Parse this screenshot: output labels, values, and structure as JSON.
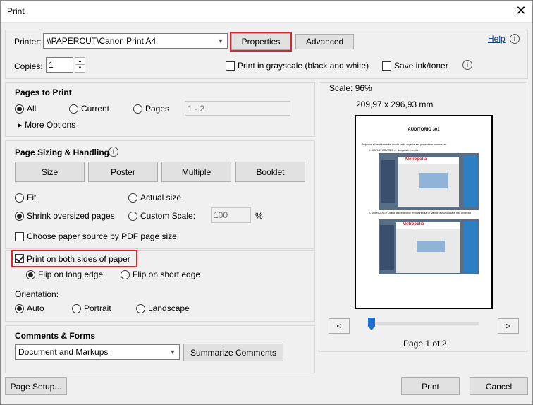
{
  "window": {
    "title": "Print"
  },
  "printer": {
    "label": "Printer:",
    "value": "\\\\PAPERCUT\\Canon Print A4",
    "properties": "Properties",
    "advanced": "Advanced",
    "help": "Help"
  },
  "copies": {
    "label": "Copies:",
    "value": "1"
  },
  "grayscale": {
    "label": "Print in grayscale (black and white)"
  },
  "save_ink": {
    "label": "Save ink/toner"
  },
  "pages_to_print": {
    "heading": "Pages to Print",
    "all": "All",
    "current": "Current",
    "pages": "Pages",
    "pages_placeholder": "1 - 2",
    "more_options": "More Options"
  },
  "sizing": {
    "heading": "Page Sizing & Handling",
    "size": "Size",
    "poster": "Poster",
    "multiple": "Multiple",
    "booklet": "Booklet",
    "fit": "Fit",
    "actual_size": "Actual size",
    "shrink": "Shrink oversized pages",
    "custom_scale": "Custom Scale:",
    "scale_value": "100",
    "percent": "%",
    "choose_source": "Choose paper source by PDF page size"
  },
  "duplex": {
    "label": "Print on both sides of paper",
    "flip_long": "Flip on long edge",
    "flip_short": "Flip on short edge"
  },
  "orientation": {
    "label": "Orientation:",
    "auto": "Auto",
    "portrait": "Portrait",
    "landscape": "Landscape"
  },
  "comments": {
    "heading": "Comments & Forms",
    "value": "Document and Markups",
    "summarize": "Summarize Comments"
  },
  "preview": {
    "scale": "Scale:  96%",
    "dimensions": "209,97 x 296,93 mm",
    "page_indicator": "Page 1 of 2",
    "prev": "<",
    "next": ">",
    "doc_title": "AUDITORIO 301",
    "doc_intro": "Projectori ei tiene kamerita, musta kablo obyekta aas proyektorim kommisaar:",
    "doc_step1": "1. DISPLAY DEVICES => Navyvesik enimeta",
    "doc_step2": "2. SOURCES => Dalisa alta projection en lisypriuoaa => Valitse laurunkuja ja el lista projektor",
    "doc_logo": "Metropolia"
  },
  "footer": {
    "page_setup": "Page Setup...",
    "print": "Print",
    "cancel": "Cancel"
  },
  "icons": {
    "close": "close-icon",
    "info": "info-icon",
    "triangle": "triangle-right-icon",
    "chevron": "chevron-down-icon"
  }
}
